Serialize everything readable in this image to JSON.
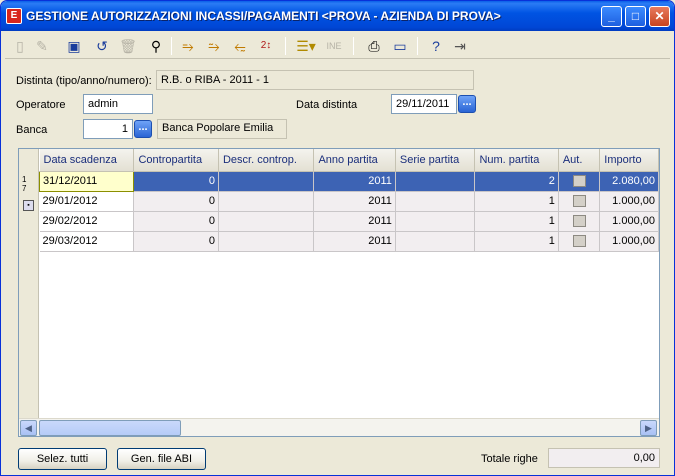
{
  "window": {
    "title": "GESTIONE AUTORIZZAZIONI INCASSI/PAGAMENTI <PROVA - AZIENDA DI PROVA>",
    "app_icon": "E",
    "controls": [
      "_",
      "□",
      "✕"
    ]
  },
  "toolbar": {
    "icons": [
      "new-icon",
      "edit-icon",
      "save-icon",
      "undo-icon",
      "delete-icon",
      "binoculars-icon",
      "run-icon",
      "run-filter-icon",
      "run-back-icon",
      "sort-icon",
      "list-icon",
      "ine-icon",
      "print-icon",
      "monitor-icon",
      "help-icon",
      "exit-icon"
    ],
    "ine_label": "INE"
  },
  "form": {
    "distinta_label": "Distinta (tipo/anno/numero):",
    "distinta_value": "R.B. o RIBA - 2011 - 1",
    "operatore_label": "Operatore",
    "operatore_value": "admin",
    "data_distinta_label": "Data distinta",
    "data_distinta_value": "29/11/2011",
    "banca_label": "Banca",
    "banca_code": "1",
    "banca_name": "Banca Popolare Emilia",
    "ellipsis": "..."
  },
  "grid": {
    "row_counter": [
      "1",
      "7"
    ],
    "columns": [
      "Data scadenza",
      "Contropartita",
      "Descr. controp.",
      "Anno partita",
      "Serie partita",
      "Num. partita",
      "Aut.",
      "Importo"
    ],
    "rows": [
      {
        "data": "31/12/2011",
        "contro": "0",
        "descr": "",
        "anno": "2011",
        "serie": "",
        "num": "2",
        "importo": "2.080,00"
      },
      {
        "data": "29/01/2012",
        "contro": "0",
        "descr": "",
        "anno": "2011",
        "serie": "",
        "num": "1",
        "importo": "1.000,00"
      },
      {
        "data": "29/02/2012",
        "contro": "0",
        "descr": "",
        "anno": "2011",
        "serie": "",
        "num": "1",
        "importo": "1.000,00"
      },
      {
        "data": "29/03/2012",
        "contro": "0",
        "descr": "",
        "anno": "2011",
        "serie": "",
        "num": "1",
        "importo": "1.000,00"
      }
    ]
  },
  "footer": {
    "select_all": "Selez. tutti",
    "gen_abi": "Gen. file ABI",
    "totale_label": "Totale righe",
    "totale_value": "0,00"
  },
  "colors": {
    "titlebar": "#0054e3",
    "selection": "#3d63b4",
    "current_cell": "#ffffcc"
  }
}
